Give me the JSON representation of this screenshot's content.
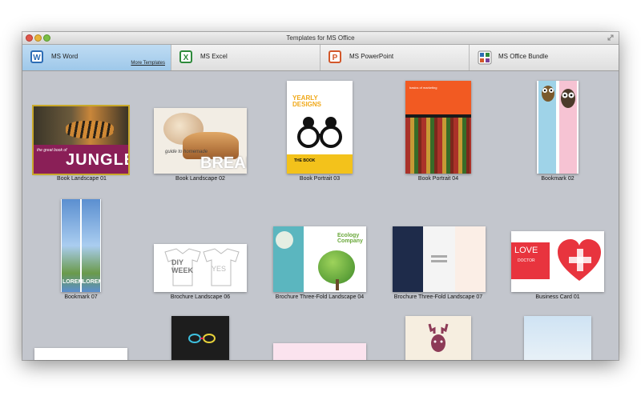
{
  "window": {
    "title": "Templates for MS Office"
  },
  "tabs": [
    {
      "label": "MS Word",
      "icon": "word-icon",
      "icon_letter": "W",
      "color": "#2d6db5"
    },
    {
      "label": "MS Excel",
      "icon": "excel-icon",
      "icon_letter": "X",
      "color": "#2e8a3b"
    },
    {
      "label": "MS PowerPoint",
      "icon": "powerpoint-icon",
      "icon_letter": "P",
      "color": "#d2572a"
    },
    {
      "label": "MS Office Bundle",
      "icon": "office-bundle-icon",
      "icon_letter": "W",
      "color": "#6a6a6a"
    }
  ],
  "more_templates": "More Templates",
  "templates": [
    {
      "caption": "Book Landscape 01",
      "text": "JUNGLE",
      "subtext": "the great book of"
    },
    {
      "caption": "Book Landscape 02",
      "text": "BREAD",
      "subtext": "guide to homemade"
    },
    {
      "caption": "Book Portrait 03",
      "text": "YEARLY DESIGNS",
      "subtext": "THE BOOK"
    },
    {
      "caption": "Book Portrait 04",
      "text": "basics of marketing"
    },
    {
      "caption": "Bookmark 02"
    },
    {
      "caption": "Bookmark 07",
      "text": "LOREM"
    },
    {
      "caption": "Brochure Landscape 06",
      "text": "DIY WEEK",
      "subtext": "YES"
    },
    {
      "caption": "Brochure Three-Fold Landscape 04",
      "text": "Ecology Company"
    },
    {
      "caption": "Brochure Three-Fold Landscape 07"
    },
    {
      "caption": "Business Card 01",
      "text": "LOVE",
      "subtext": "DOCTOR"
    }
  ],
  "colors": {
    "accent": "#9ec8ea",
    "selection": "#c9a82a",
    "background": "#c3c6cd"
  }
}
